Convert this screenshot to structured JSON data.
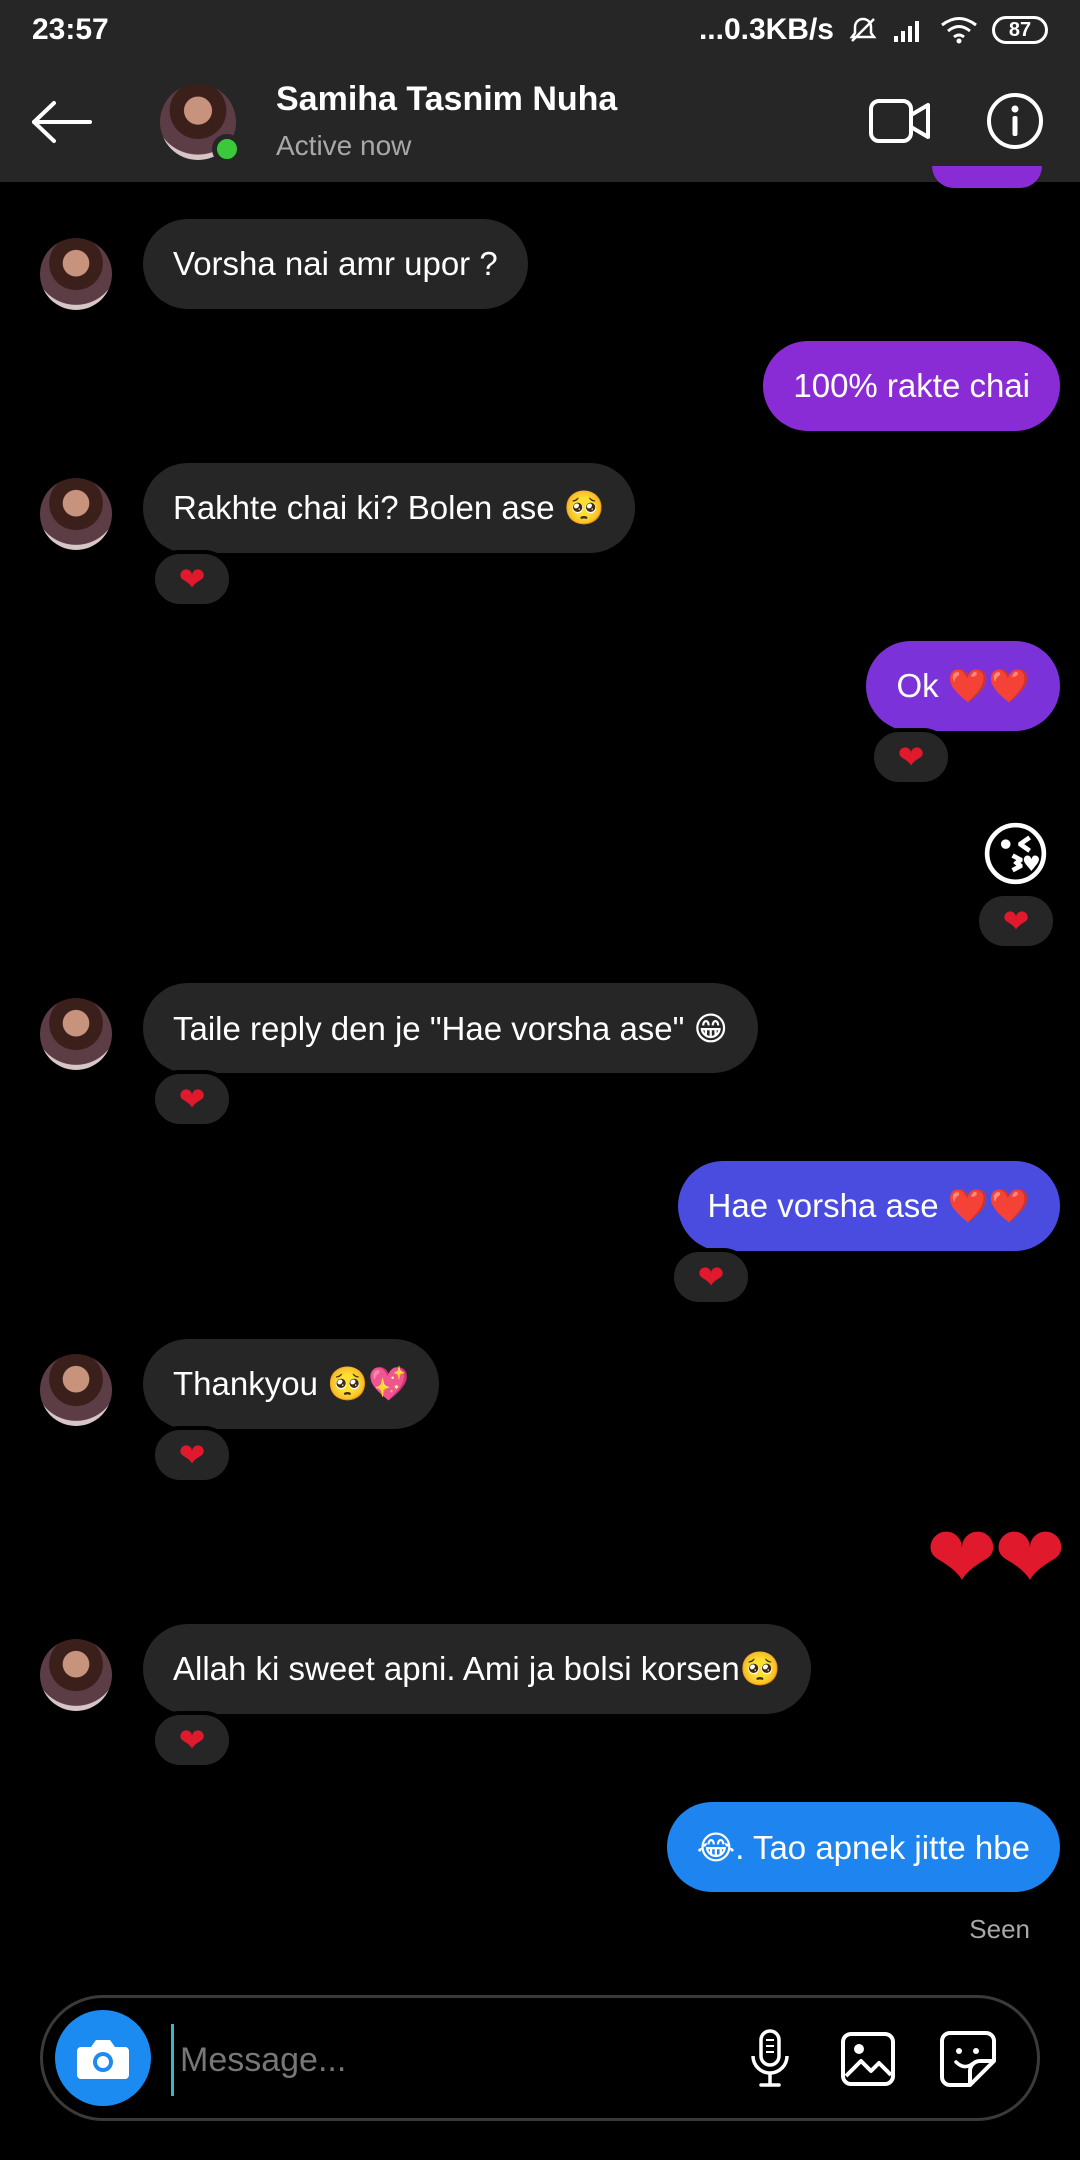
{
  "status_bar": {
    "time": "23:57",
    "network_speed": "...0.3KB/s",
    "battery": "87"
  },
  "header": {
    "contact_name": "Samiha Tasnim Nuha",
    "contact_status": "Active now"
  },
  "messages": [
    {
      "dir": "in",
      "text": "Vorsha nai amr upor ?"
    },
    {
      "dir": "out",
      "text": "100% rakte chai",
      "color": "#8a2cd6"
    },
    {
      "dir": "in",
      "text": "Rakhte chai ki? Bolen ase 🥺",
      "reaction": "❤"
    },
    {
      "dir": "out",
      "text": "Ok ❤️❤️",
      "color": "#7b33d9",
      "reaction": "❤"
    },
    {
      "dir": "out",
      "text": "😘",
      "reaction": "❤"
    },
    {
      "dir": "in",
      "text": "Taile reply den je \"Hae vorsha ase\" 😁",
      "reaction": "❤"
    },
    {
      "dir": "out",
      "text": "Hae vorsha ase ❤️❤️",
      "color": "#4a4ce0",
      "reaction": "❤"
    },
    {
      "dir": "in",
      "text": "Thankyou 🥺💖",
      "reaction": "❤"
    },
    {
      "dir": "out",
      "text": "❤❤"
    },
    {
      "dir": "in",
      "text": "Allah ki sweet apni. Ami ja bolsi korsen🥺",
      "reaction": "❤"
    },
    {
      "dir": "out",
      "text": "😂. Tao apnek jitte hbe",
      "color": "#1d84f0"
    }
  ],
  "seen_label": "Seen",
  "composer": {
    "placeholder": "Message..."
  },
  "icons": {
    "back": "arrow-left-icon",
    "video": "video-camera-icon",
    "info": "info-icon",
    "camera": "camera-icon",
    "mic": "microphone-icon",
    "gallery": "image-icon",
    "sticker": "sticker-icon"
  },
  "colors": {
    "header_bg": "#262626",
    "incoming_bubble": "#262626",
    "online": "#3ac93a",
    "camera_button": "#1b8bf2"
  }
}
